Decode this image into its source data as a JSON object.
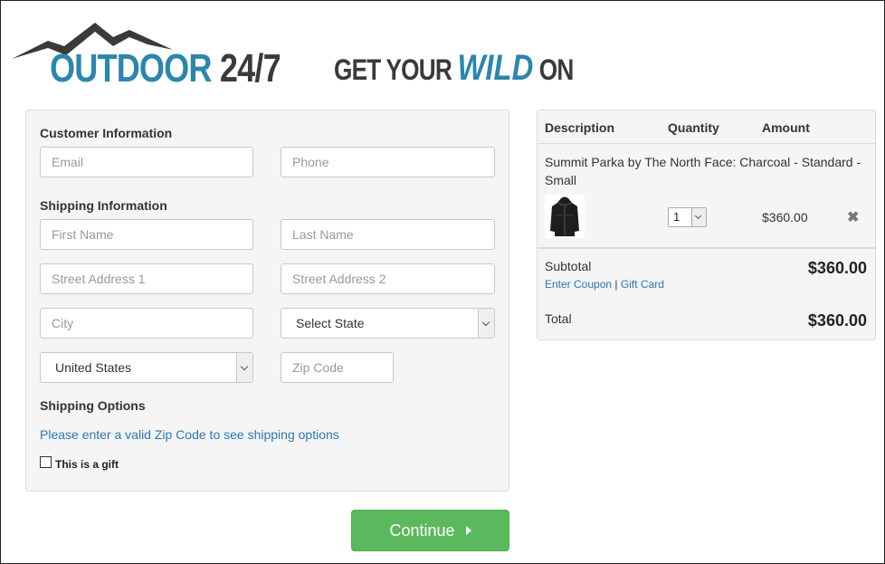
{
  "brand": {
    "logo_primary": "OUTDOOR",
    "logo_secondary": "24/7",
    "tagline_pre": "GET YOUR",
    "tagline_wild": "WILD",
    "tagline_post": "ON",
    "colors": {
      "blue": "#2b86ad",
      "dark": "#3a3a3a"
    }
  },
  "form": {
    "customer_title": "Customer Information",
    "email_placeholder": "Email",
    "phone_placeholder": "Phone",
    "shipping_title": "Shipping Information",
    "first_name_placeholder": "First Name",
    "last_name_placeholder": "Last Name",
    "street1_placeholder": "Street Address 1",
    "street2_placeholder": "Street Address 2",
    "city_placeholder": "City",
    "state_selected": "Select State",
    "country_selected": "United States",
    "zip_placeholder": "Zip Code",
    "shipping_options_title": "Shipping Options",
    "shipping_options_msg": "Please enter a valid Zip Code to see shipping options",
    "gift_label": "This is a gift",
    "gift_checked": false
  },
  "actions": {
    "continue_label": "Continue",
    "continue_color": "#5cb85c"
  },
  "cart": {
    "headers": {
      "description": "Description",
      "quantity": "Quantity",
      "amount": "Amount"
    },
    "items": [
      {
        "description": "Summit Parka by The North Face: Charcoal - Standard - Small",
        "image_icon": "parka-icon",
        "quantity": "1",
        "amount": "$360.00"
      }
    ],
    "subtotal_label": "Subtotal",
    "subtotal_value": "$360.00",
    "enter_coupon": "Enter Coupon",
    "separator": "|",
    "gift_card": "Gift Card",
    "total_label": "Total",
    "total_value": "$360.00"
  }
}
